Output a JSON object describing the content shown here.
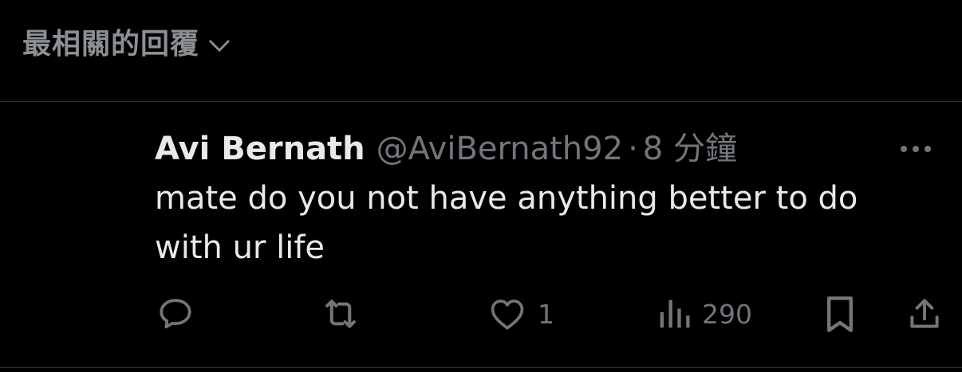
{
  "header": {
    "sort_label": "最相關的回覆"
  },
  "reply": {
    "author_name": "Avi Bernath",
    "author_handle": "@AviBernath92",
    "separator": "·",
    "timestamp": "8 分鐘",
    "text": "mate do you not have anything better to do with ur life"
  },
  "actions": {
    "like_count": "1",
    "views_count": "290"
  },
  "colors": {
    "background": "#000000",
    "primary_text": "#e7e9ea",
    "secondary_text": "#71767b",
    "divider": "#2f3336"
  },
  "icons": {
    "sort": "chevron-down-icon",
    "more": "more-icon",
    "reply": "comment-icon",
    "repost": "repost-icon",
    "like": "heart-icon",
    "views": "views-icon",
    "bookmark": "bookmark-icon",
    "share": "share-icon"
  }
}
